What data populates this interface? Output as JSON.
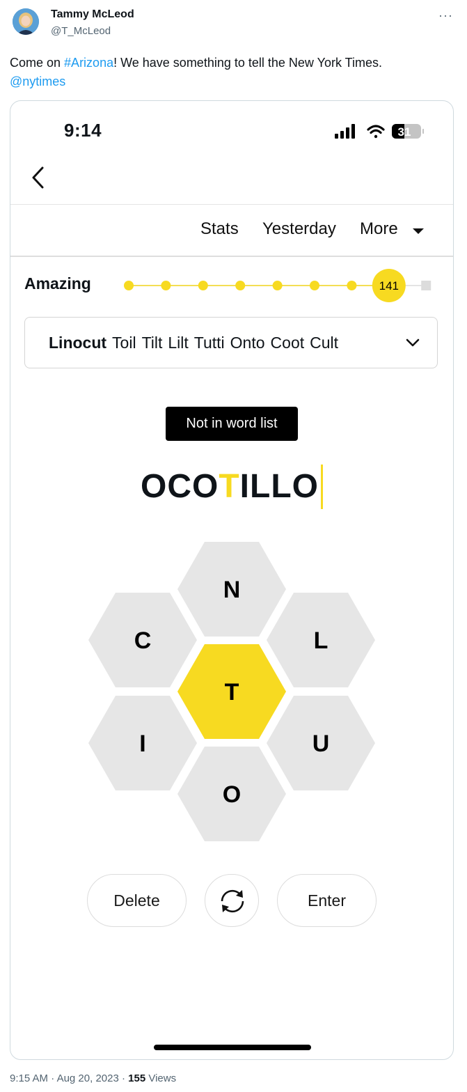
{
  "tweet": {
    "author_name": "Tammy McLeod",
    "author_handle": "@T_McLeod",
    "more_icon": "ellipsis-icon",
    "text_before": "Come on ",
    "hashtag": "#Arizona",
    "text_after": "! We have something to tell the New York Times.",
    "mention": "@nytimes",
    "time": "9:15 AM",
    "separator1": " · ",
    "date": "Aug 20, 2023",
    "separator2": " · ",
    "views_count": "155",
    "views_label": "Views",
    "link_color": "#1d9bf0"
  },
  "phone": {
    "status_time": "9:14",
    "battery_level": "31",
    "nav": {
      "stats": "Stats",
      "yesterday": "Yesterday",
      "more": "More"
    },
    "rank": {
      "label": "Amazing",
      "score": "141",
      "steps_total": 9,
      "current_step_index": 7
    },
    "found_words": [
      "Linocut",
      "Toil",
      "Tilt",
      "Lilt",
      "Tutti",
      "Onto",
      "Coot",
      "Cult"
    ],
    "toast": "Not in word list",
    "entry": {
      "before": "OCO",
      "center": "T",
      "after": "ILLO"
    },
    "hive": {
      "center": "T",
      "outer": [
        "N",
        "L",
        "U",
        "O",
        "I",
        "C"
      ]
    },
    "buttons": {
      "delete": "Delete",
      "shuffle_icon": "shuffle-icon",
      "enter": "Enter"
    },
    "colors": {
      "accent_yellow": "#f7da21",
      "cell_gray": "#e6e6e6"
    }
  }
}
